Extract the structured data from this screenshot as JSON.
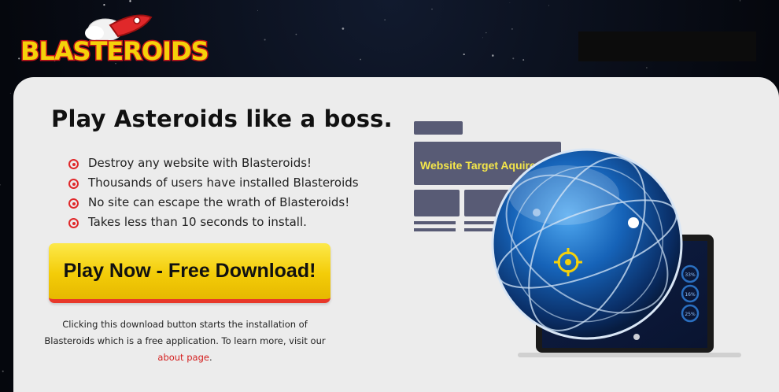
{
  "brand": {
    "name": "BLASTEROIDS",
    "colors": {
      "red": "#e0282a",
      "yellow": "#f5d10a",
      "card": "#ececec"
    }
  },
  "hero": {
    "headline": "Play Asteroids like a boss.",
    "features": [
      "Destroy any website with Blasteroids!",
      "Thousands of users have installed Blasteroids",
      "No site can escape the wrath of Blasteroids!",
      "Takes less than 10 seconds to install."
    ],
    "cta_label": "Play Now - Free Download!",
    "disclaimer_text": "Clicking this download button starts the installation of Blasteroids which is a free application. To learn more, visit our",
    "disclaimer_link": "about page",
    "disclaimer_end": "."
  },
  "illustration": {
    "target_text": "Website Target Aquired.",
    "gauges": [
      "33%",
      "16%",
      "25%"
    ]
  }
}
